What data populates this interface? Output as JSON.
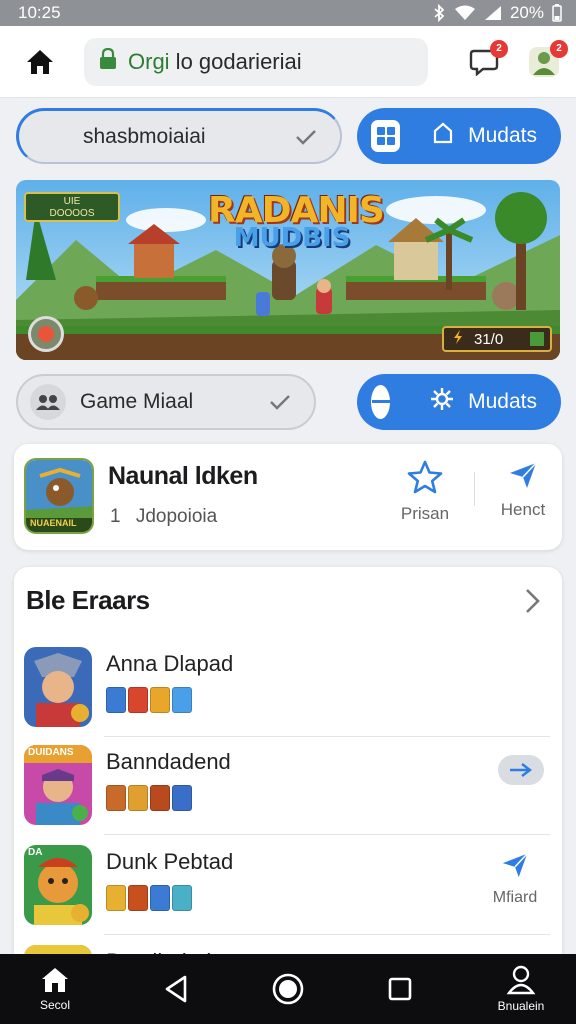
{
  "status_bar": {
    "time": "10:25",
    "battery": "20%"
  },
  "address_bar": {
    "prefix": "Orgi",
    "rest": " lo godarieriai"
  },
  "badges": {
    "notifications": "2",
    "profile": "2"
  },
  "row1": {
    "select_value": "shasbmoiaiai",
    "button_label": "Mudats"
  },
  "banner": {
    "tag_line1": "UIE",
    "tag_line2": "DOOOOS",
    "title_line1": "RADANIS",
    "title_line2": "MUDBIS",
    "score": "31/0"
  },
  "row2": {
    "select_value": "Game Miaal",
    "button_label": "Mudats"
  },
  "featured": {
    "title": "Naunal ldken",
    "number": "1",
    "subtitle": "Jdopoioia",
    "icon_label": "NUAENAIL",
    "action1_label": "Prisan",
    "action2_label": "Henct"
  },
  "list": {
    "heading": "Ble Eraars",
    "items": [
      {
        "name": "Anna Dlapad",
        "tag_colors": [
          "#3b7bd4",
          "#d8462e",
          "#e8a72a",
          "#4aa0e8"
        ]
      },
      {
        "name": "Banndadend",
        "icon_label": "DUIDANS",
        "tag_colors": [
          "#c86a2a",
          "#e0a030",
          "#b84a1e",
          "#3b6ec8"
        ]
      },
      {
        "name": "Dunk Pebtad",
        "icon_label": "DA",
        "action_label": "Mfiard",
        "tag_colors": [
          "#e8b030",
          "#c8501e",
          "#3b7bd4",
          "#4ab0c8"
        ]
      },
      {
        "name": "Bandindod"
      }
    ]
  },
  "nav": {
    "left_label": "Secol",
    "right_label": "Bnualein"
  },
  "colors": {
    "accent": "#2f7de1",
    "badge": "#e53935",
    "nav_bg": "#0d0d0f"
  }
}
